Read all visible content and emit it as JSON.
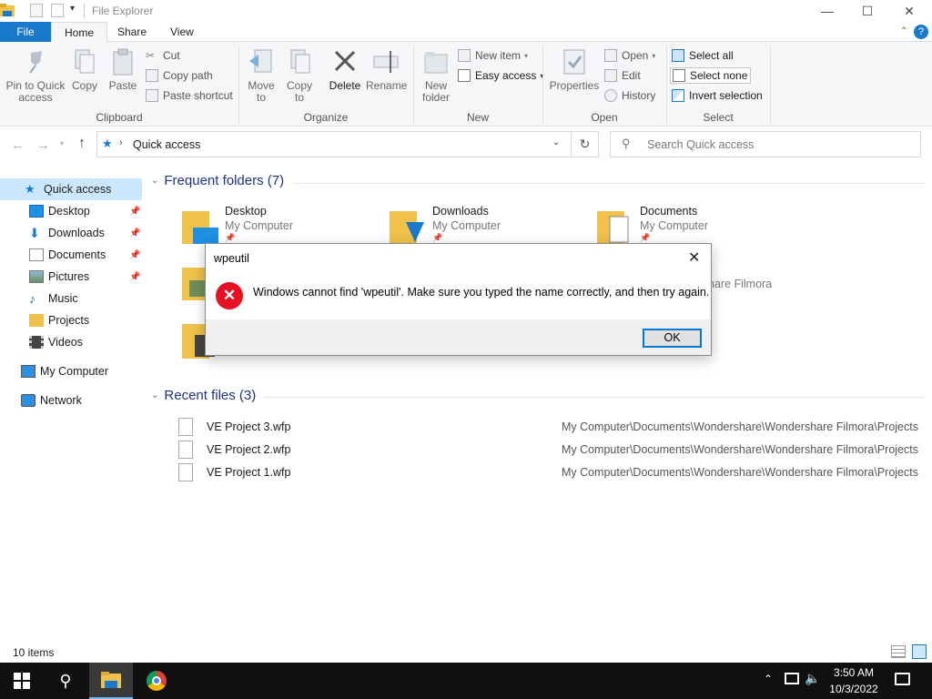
{
  "window": {
    "title": "File Explorer",
    "minimize_glyph": "—",
    "maximize_glyph": "☐",
    "close_glyph": "✕"
  },
  "tabs": {
    "file": "File",
    "home": "Home",
    "share": "Share",
    "view": "View"
  },
  "ribbon": {
    "clipboard": {
      "label": "Clipboard",
      "pin": "Pin to Quick access",
      "copy": "Copy",
      "paste": "Paste",
      "cut": "Cut",
      "copy_path": "Copy path",
      "paste_shortcut": "Paste shortcut"
    },
    "organize": {
      "label": "Organize",
      "move_to": "Move to",
      "copy_to": "Copy to",
      "delete": "Delete",
      "rename": "Rename"
    },
    "new": {
      "label": "New",
      "new_folder": "New folder",
      "new_item": "New item",
      "easy_access": "Easy access"
    },
    "open": {
      "label": "Open",
      "properties": "Properties",
      "open": "Open",
      "edit": "Edit",
      "history": "History"
    },
    "select": {
      "label": "Select",
      "select_all": "Select all",
      "select_none": "Select none",
      "invert_selection": "Invert selection"
    }
  },
  "address": {
    "path": "Quick access",
    "search_placeholder": "Search Quick access"
  },
  "nav_pane": {
    "quick_access": "Quick access",
    "items": [
      {
        "label": "Desktop"
      },
      {
        "label": "Downloads"
      },
      {
        "label": "Documents"
      },
      {
        "label": "Pictures"
      },
      {
        "label": "Music"
      },
      {
        "label": "Projects"
      },
      {
        "label": "Videos"
      }
    ],
    "my_computer": "My Computer",
    "network": "Network"
  },
  "frequent": {
    "header": "Frequent folders (7)",
    "folders": [
      {
        "name": "Desktop",
        "location": "My Computer"
      },
      {
        "name": "Downloads",
        "location": "My Computer"
      },
      {
        "name": "Documents",
        "location": "My Computer"
      }
    ],
    "partial_text": "hare Filmora"
  },
  "recent": {
    "header": "Recent files (3)",
    "files": [
      {
        "name": "VE Project 3.wfp",
        "path": "My Computer\\Documents\\Wondershare\\Wondershare Filmora\\Projects"
      },
      {
        "name": "VE Project 2.wfp",
        "path": "My Computer\\Documents\\Wondershare\\Wondershare Filmora\\Projects"
      },
      {
        "name": "VE Project 1.wfp",
        "path": "My Computer\\Documents\\Wondershare\\Wondershare Filmora\\Projects"
      }
    ]
  },
  "status": {
    "items": "10 items"
  },
  "dialog": {
    "title": "wpeutil",
    "message": "Windows cannot find 'wpeutil'. Make sure you typed the name correctly, and then try again.",
    "ok": "OK"
  },
  "taskbar": {
    "time": "3:50 AM",
    "date": "10/3/2022"
  },
  "colors": {
    "accent": "#1979ca",
    "error": "#e81123",
    "folder": "#f0c24b",
    "taskbar": "#101010"
  }
}
